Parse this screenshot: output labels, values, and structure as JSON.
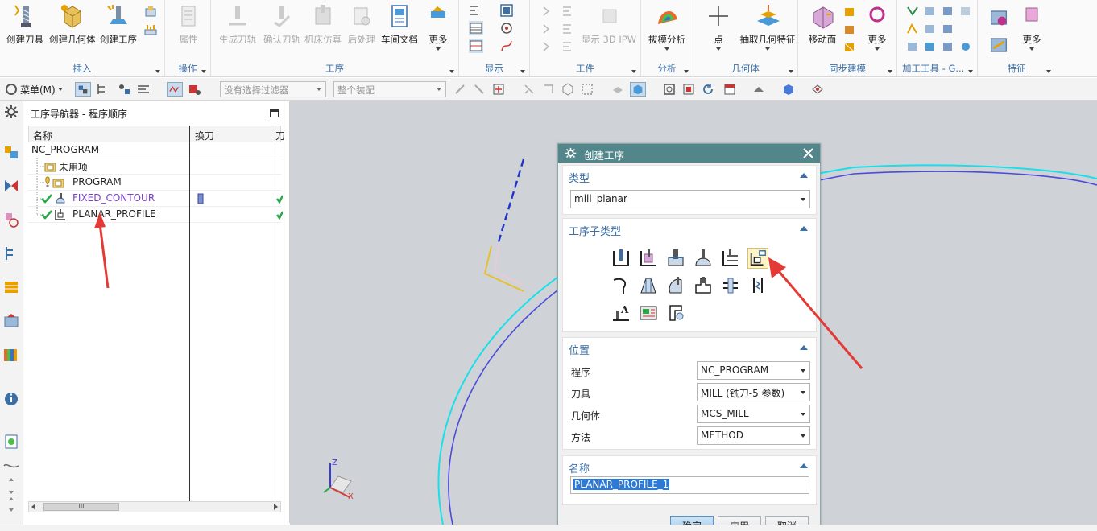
{
  "ribbon": {
    "groups": [
      {
        "label": "插入",
        "buttons": [
          "创建刀具",
          "创建几何体",
          "创建工序"
        ]
      },
      {
        "label": "操作",
        "buttons": [
          "属性"
        ]
      },
      {
        "label": "工序",
        "buttons": [
          "生成刀轨",
          "确认刀轨",
          "机床仿真",
          "后处理",
          "车间文档",
          "更多"
        ]
      },
      {
        "label": "显示"
      },
      {
        "label": "工件",
        "buttons": [
          "显示 3D IPW"
        ]
      },
      {
        "label": "分析",
        "buttons": [
          "拔模分析"
        ]
      },
      {
        "label": "几何体",
        "buttons": [
          "点",
          "抽取几何特征"
        ]
      },
      {
        "label": "同步建模",
        "buttons": [
          "移动面",
          "更多"
        ]
      },
      {
        "label": "加工工具 - G..."
      },
      {
        "label": "特征",
        "buttons": [
          "更多"
        ]
      }
    ]
  },
  "toolbar2": {
    "menu_label": "菜单(M)",
    "filter_placeholder": "没有选择过滤器",
    "assembly_scope": "整个装配"
  },
  "navigator": {
    "title": "工序导航器 - 程序顺序",
    "columns": [
      "名称",
      "换刀",
      "刀"
    ],
    "rows": [
      {
        "name": "NC_PROGRAM",
        "level": 0
      },
      {
        "name": "未用项",
        "level": 1
      },
      {
        "name": "PROGRAM",
        "level": 1
      },
      {
        "name": "FIXED_CONTOUR",
        "level": 1,
        "color": "#7a3fc8"
      },
      {
        "name": "PLANAR_PROFILE",
        "level": 1
      }
    ],
    "scroll_thumb": "III"
  },
  "dialog": {
    "title": "创建工序",
    "type_section": "类型",
    "type_value": "mill_planar",
    "subtype_section": "工序子类型",
    "location_section": "位置",
    "fields": [
      {
        "label": "程序",
        "value": "NC_PROGRAM"
      },
      {
        "label": "刀具",
        "value": "MILL (铣刀-5 参数)"
      },
      {
        "label": "几何体",
        "value": "MCS_MILL"
      },
      {
        "label": "方法",
        "value": "METHOD"
      }
    ],
    "name_section": "名称",
    "name_value": "PLANAR_PROFILE_1",
    "buttons": {
      "ok": "确定",
      "apply": "应用",
      "cancel": "取消"
    }
  },
  "viewport": {
    "axis_z": "Z",
    "axis_x": "X"
  },
  "colors": {
    "accent": "#3a6ea5",
    "dialog_title": "#52868a",
    "arrow": "#e53935",
    "curve_cyan": "#19e0e8",
    "curve_blue": "#4b4bd8"
  }
}
